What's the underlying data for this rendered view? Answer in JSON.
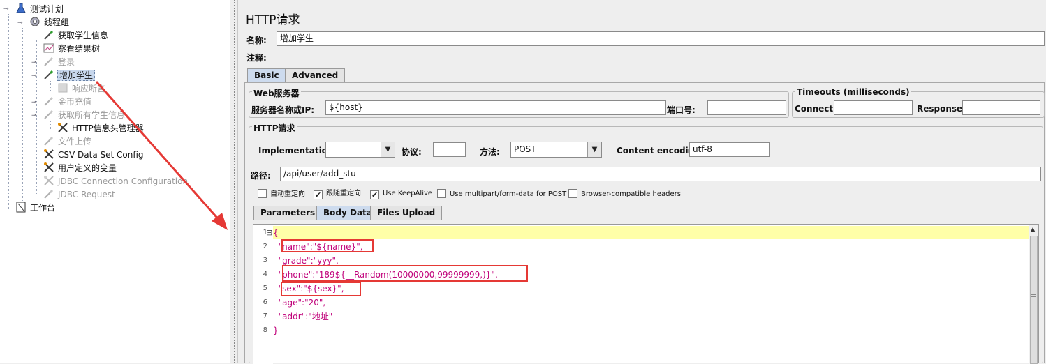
{
  "tree": {
    "items": [
      {
        "label": "测试计划",
        "icon": "flask-icon",
        "disabled": false,
        "selected": false
      },
      {
        "label": "线程组",
        "icon": "gear-icon",
        "disabled": false,
        "selected": false
      },
      {
        "label": "获取学生信息",
        "icon": "pipette-icon",
        "disabled": false,
        "selected": false
      },
      {
        "label": "察看结果树",
        "icon": "chart-icon",
        "disabled": false,
        "selected": false
      },
      {
        "label": "登录",
        "icon": "pipette-icon",
        "disabled": true,
        "selected": false
      },
      {
        "label": "增加学生",
        "icon": "pipette-icon",
        "disabled": false,
        "selected": true
      },
      {
        "label": "响应断言",
        "icon": "assertion-icon",
        "disabled": true,
        "selected": false
      },
      {
        "label": "金币充值",
        "icon": "pipette-icon",
        "disabled": true,
        "selected": false
      },
      {
        "label": "获取所有学生信息",
        "icon": "pipette-icon",
        "disabled": true,
        "selected": false
      },
      {
        "label": "HTTP信息头管理器",
        "icon": "wrench-icon",
        "disabled": false,
        "selected": false
      },
      {
        "label": "文件上传",
        "icon": "pipette-icon",
        "disabled": true,
        "selected": false
      },
      {
        "label": "CSV Data Set Config",
        "icon": "wrench-icon",
        "disabled": false,
        "selected": false
      },
      {
        "label": "用户定义的变量",
        "icon": "wrench-icon",
        "disabled": false,
        "selected": false
      },
      {
        "label": "JDBC Connection Configuration",
        "icon": "wrench-icon",
        "disabled": true,
        "selected": false
      },
      {
        "label": "JDBC Request",
        "icon": "pipette-icon",
        "disabled": true,
        "selected": false
      },
      {
        "label": "工作台",
        "icon": "workbench-icon",
        "disabled": false,
        "selected": false
      }
    ]
  },
  "panel": {
    "title": "HTTP请求",
    "name_label": "名称:",
    "name_value": "增加学生",
    "comment_label": "注释:",
    "tabs": [
      "Basic",
      "Advanced"
    ],
    "web_server": {
      "legend": "Web服务器",
      "server_label": "服务器名称或IP:",
      "server_value": "${host}",
      "port_label": "端口号:",
      "port_value": ""
    },
    "timeouts": {
      "legend": "Timeouts (milliseconds)",
      "connect_label": "Connect:",
      "connect_value": "",
      "response_label": "Response:",
      "response_value": ""
    },
    "http_request": {
      "legend": "HTTP请求",
      "implementation_label": "Implementation:",
      "implementation_value": "",
      "protocol_label": "协议:",
      "protocol_value": "",
      "method_label": "方法:",
      "method_value": "POST",
      "encoding_label": "Content encoding:",
      "encoding_value": "utf-8",
      "path_label": "路径:",
      "path_value": "/api/user/add_stu"
    },
    "checkboxes": [
      {
        "label": "自动重定向",
        "checked": false
      },
      {
        "label": "跟随重定向",
        "checked": true
      },
      {
        "label": "Use KeepAlive",
        "checked": true
      },
      {
        "label": "Use multipart/form-data for POST",
        "checked": false
      },
      {
        "label": "Browser-compatible headers",
        "checked": false
      }
    ],
    "body_tabs": [
      "Parameters",
      "Body Data",
      "Files Upload"
    ],
    "code_lines": [
      {
        "n": "1",
        "text": "{"
      },
      {
        "n": "2",
        "text": "  \"name\":\"${name}\","
      },
      {
        "n": "3",
        "text": "  \"grade\":\"yyy\","
      },
      {
        "n": "4",
        "text": "  \"phone\":\"189${__Random(10000000,99999999,)}\","
      },
      {
        "n": "5",
        "text": "  \"sex\":\"${sex}\","
      },
      {
        "n": "6",
        "text": "  \"age\":\"20\","
      },
      {
        "n": "7",
        "text": "  \"addr\":\"地址\""
      },
      {
        "n": "8",
        "text": "}"
      }
    ],
    "fold_marker": "⊟"
  },
  "colors": {
    "selection": "#c7d7ec",
    "current_line": "#ffffa8",
    "string_color": "#c0007a",
    "highlight_box": "#e53935",
    "arrow": "#e53935"
  }
}
